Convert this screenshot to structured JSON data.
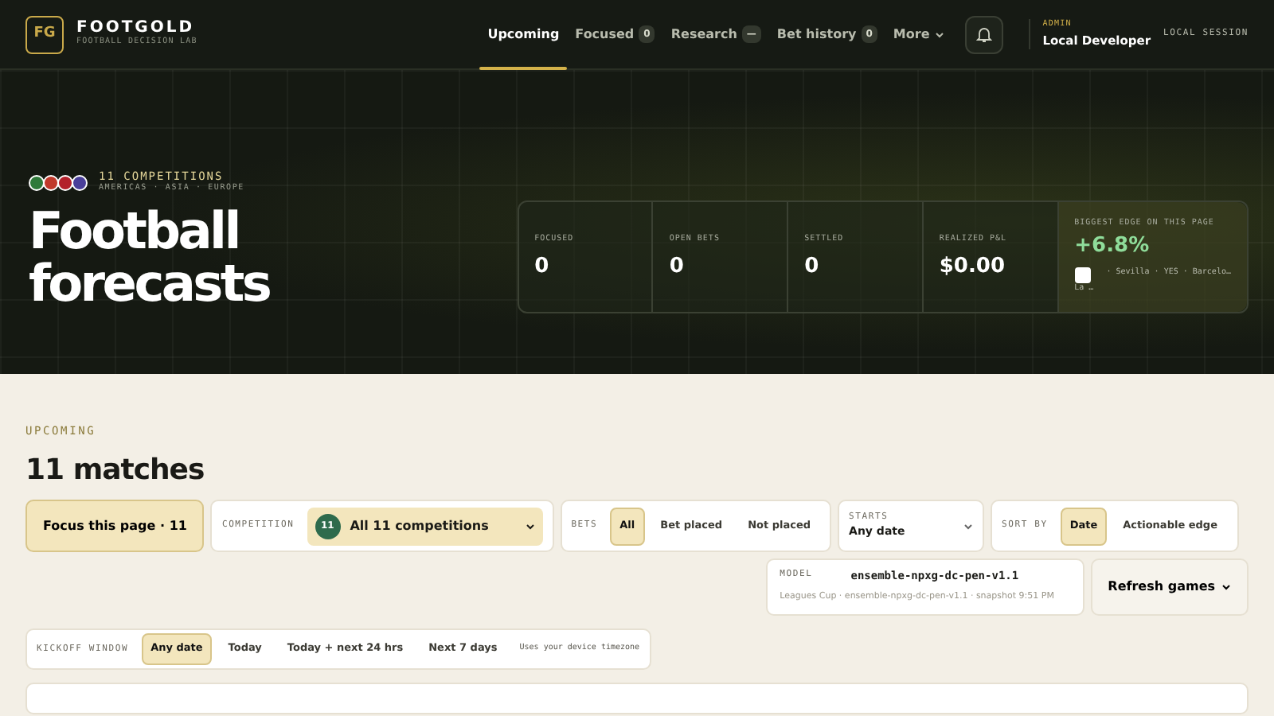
{
  "brand": {
    "mark": "FG",
    "name": "FOOTGOLD",
    "tagline": "FOOTBALL DECISION LAB"
  },
  "nav": [
    {
      "label": "Upcoming",
      "selected": true
    },
    {
      "label": "Focused",
      "count": "0",
      "selected": false
    },
    {
      "label": "Research",
      "count": "—",
      "selected": false
    },
    {
      "label": "Bet history",
      "count": "0",
      "selected": false
    },
    {
      "label": "More",
      "caret": true,
      "selected": false
    }
  ],
  "user": {
    "role": "ADMIN",
    "name": "Local Developer",
    "session": "LOCAL SESSION"
  },
  "hero": {
    "competitions": "11 COMPETITIONS",
    "regions": "AMERICAS · ASIA · EUROPE",
    "title": "Football forecasts",
    "stats": [
      {
        "label": "FOCUSED",
        "value": "0"
      },
      {
        "label": "OPEN BETS",
        "value": "0"
      },
      {
        "label": "SETTLED",
        "value": "0"
      },
      {
        "label": "REALIZED P&L",
        "value": "$0.00"
      }
    ],
    "edge": {
      "label": "BIGGEST EDGE ON THIS PAGE",
      "value": "+6.8%",
      "match": "· Sevilla · YES · Barcelo…",
      "league": "La …"
    }
  },
  "section": {
    "eyebrow": "UPCOMING",
    "title": "11 matches"
  },
  "focus_button": "Focus this page · 11",
  "competition": {
    "label": "COMPETITION",
    "count": "11",
    "value": "All 11 competitions"
  },
  "bets": {
    "label": "BETS",
    "options": [
      {
        "label": "All",
        "selected": true
      },
      {
        "label": "Bet placed",
        "selected": false
      },
      {
        "label": "Not placed",
        "selected": false
      }
    ]
  },
  "starts": {
    "label": "STARTS",
    "value": "Any date"
  },
  "sort": {
    "label": "SORT BY",
    "options": [
      {
        "label": "Date",
        "selected": true
      },
      {
        "label": "Actionable edge",
        "selected": false
      }
    ]
  },
  "model": {
    "label": "MODEL",
    "name": "ensemble-npxg-dc-pen-v1.1",
    "detail": "Leagues Cup · ensemble-npxg-dc-pen-v1.1 · snapshot 9:51 PM"
  },
  "refresh_button": "Refresh games",
  "kickoff": {
    "label": "KICKOFF WINDOW",
    "options": [
      {
        "label": "Any date",
        "selected": true
      },
      {
        "label": "Today",
        "selected": false
      },
      {
        "label": "Today + next 24 hrs",
        "selected": false
      },
      {
        "label": "Next 7 days",
        "selected": false
      }
    ],
    "note": "Uses your device timezone"
  }
}
